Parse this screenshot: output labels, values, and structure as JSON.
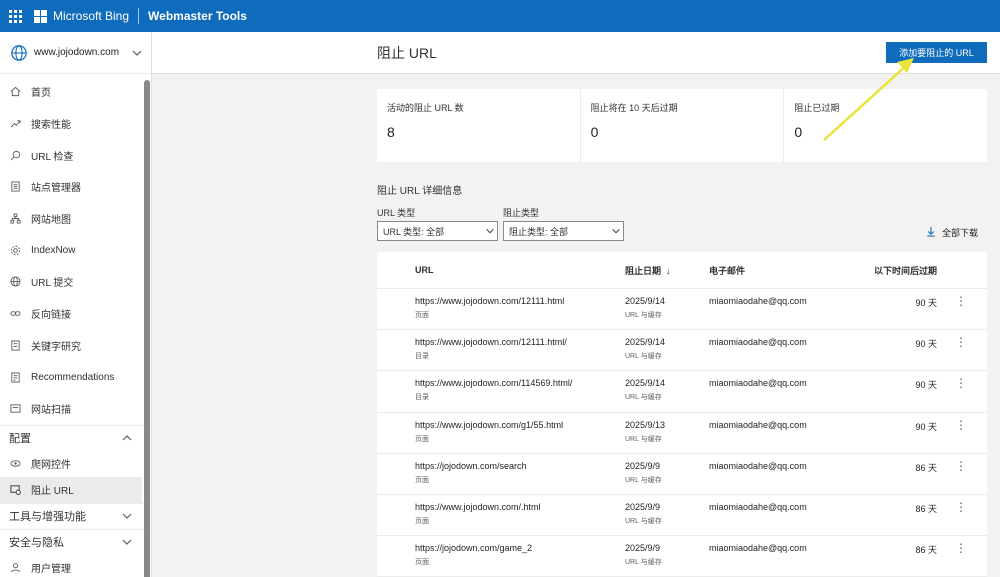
{
  "topbar": {
    "brand": "Microsoft Bing",
    "product": "Webmaster Tools"
  },
  "sidebar": {
    "site": "www.jojodown.com",
    "items": [
      {
        "label": "首页",
        "icon": "home-icon"
      },
      {
        "label": "搜索性能",
        "icon": "trend-icon"
      },
      {
        "label": "URL 检查",
        "icon": "search-icon"
      },
      {
        "label": "站点管理器",
        "icon": "document-icon"
      },
      {
        "label": "网站地图",
        "icon": "sitemap-icon"
      },
      {
        "label": "IndexNow",
        "icon": "gear-icon"
      },
      {
        "label": "URL 提交",
        "icon": "globe-icon"
      },
      {
        "label": "反向链接",
        "icon": "link-icon"
      },
      {
        "label": "关键字研究",
        "icon": "document-icon"
      },
      {
        "label": "Recommendations",
        "icon": "list-icon"
      },
      {
        "label": "网站扫描",
        "icon": "scan-icon"
      }
    ],
    "config_section": "配置",
    "config_items": [
      {
        "label": "爬网控件",
        "icon": "eye-icon"
      },
      {
        "label": "阻止 URL",
        "icon": "block-icon"
      }
    ],
    "tools_section": "工具与增强功能",
    "security_section": "安全与隐私",
    "user_mgmt": "用户管理"
  },
  "header": {
    "title": "阻止 URL",
    "add_button": "添加要阻止的 URL"
  },
  "stats": [
    {
      "label": "活动的阻止 URL 数",
      "value": "8"
    },
    {
      "label": "阻止将在 10 天后过期",
      "value": "0"
    },
    {
      "label": "阻止已过期",
      "value": "0"
    }
  ],
  "details": {
    "title": "阻止 URL 详细信息",
    "url_type_label": "URL 类型",
    "url_type_value": "URL 类型: 全部",
    "block_type_label": "阻止类型",
    "block_type_value": "阻止类型: 全部",
    "download": "全部下载"
  },
  "table": {
    "headers": {
      "url": "URL",
      "date": "阻止日期",
      "email": "电子邮件",
      "expires": "以下时间后过期"
    },
    "rows": [
      {
        "url": "https://www.jojodown.com/12111.html",
        "type": "页面",
        "date": "2025/9/14",
        "block": "URL 与缓存",
        "email": "miaomiaodahe@qq.com",
        "expires": "90 天"
      },
      {
        "url": "https://www.jojodown.com/12111.html/",
        "type": "目录",
        "date": "2025/9/14",
        "block": "URL 与缓存",
        "email": "miaomiaodahe@qq.com",
        "expires": "90 天"
      },
      {
        "url": "https://www.jojodown.com/114569.html/",
        "type": "目录",
        "date": "2025/9/14",
        "block": "URL 与缓存",
        "email": "miaomiaodahe@qq.com",
        "expires": "90 天"
      },
      {
        "url": "https://www.jojodown.com/g1/55.html",
        "type": "页面",
        "date": "2025/9/13",
        "block": "URL 与缓存",
        "email": "miaomiaodahe@qq.com",
        "expires": "90 天"
      },
      {
        "url": "https://jojodown.com/search",
        "type": "页面",
        "date": "2025/9/9",
        "block": "URL 与缓存",
        "email": "miaomiaodahe@qq.com",
        "expires": "86 天"
      },
      {
        "url": "https://www.jojodown.com/.html",
        "type": "页面",
        "date": "2025/9/9",
        "block": "URL 与缓存",
        "email": "miaomiaodahe@qq.com",
        "expires": "86 天"
      },
      {
        "url": "https://jojodown.com/game_2",
        "type": "页面",
        "date": "2025/9/9",
        "block": "URL 与缓存",
        "email": "miaomiaodahe@qq.com",
        "expires": "86 天"
      }
    ]
  },
  "colors": {
    "accent": "#0f6cbd",
    "annotation_arrow": "#e8e43a"
  }
}
